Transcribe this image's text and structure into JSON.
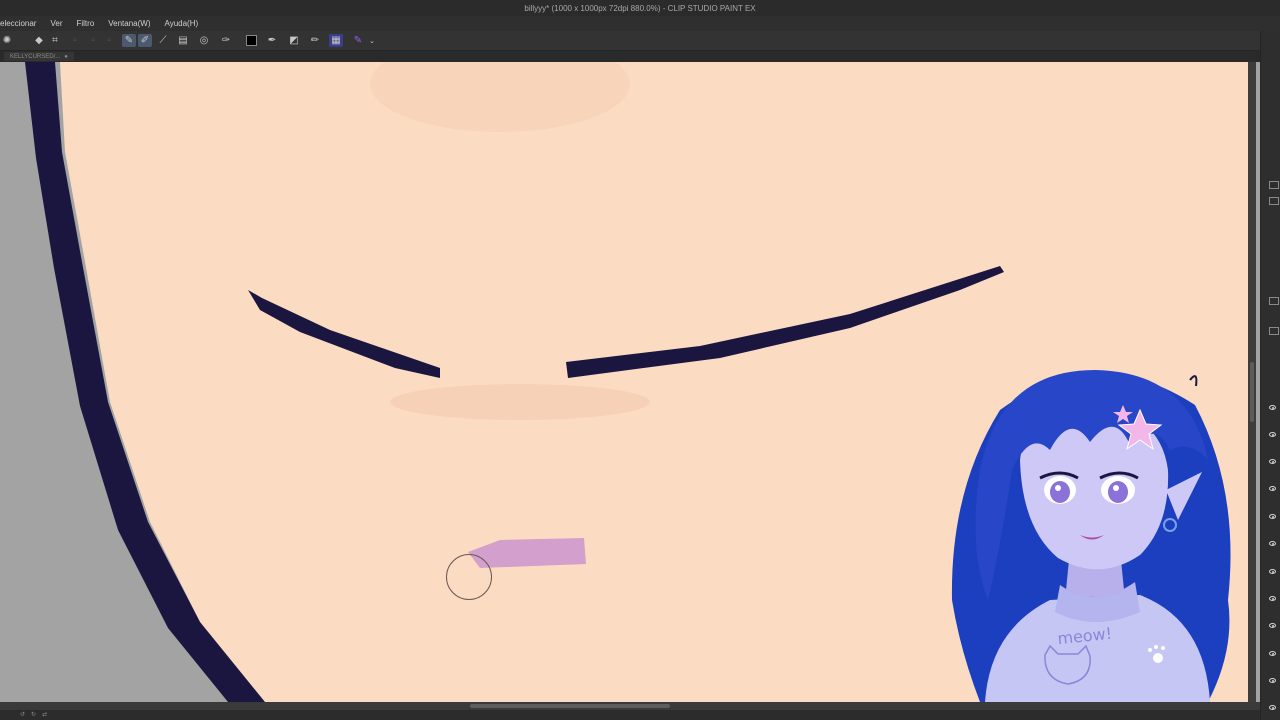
{
  "window": {
    "title": "billyyy* (1000 x 1000px 72dpi 880.0%)  - CLIP STUDIO PAINT EX"
  },
  "menu": {
    "items": [
      "eleccionar",
      "Ver",
      "Filtro",
      "Ventana(W)",
      "Ayuda(H)"
    ]
  },
  "command_bar": {
    "tools": [
      "loading-spinner-icon",
      "move-icon",
      "transform-icon",
      "blank-tool-icon",
      "blank-tool-icon",
      "blank-tool-icon",
      "pen-active-icon",
      "pen-edit-icon",
      "ruler-icon",
      "layer-property-icon",
      "lasso-icon",
      "pencil-icon",
      "color-square-icon",
      "eyedropper-icon",
      "selection-icon",
      "vector-pen-icon",
      "layer-color-icon",
      "purple-pen-icon"
    ],
    "colors": {
      "main_color": "#000000",
      "accent_purple": "#7a3fd6"
    }
  },
  "tab": {
    "label": "KELLYCURSED/..."
  },
  "canvas": {
    "background_skin": "#fbdcc2",
    "line_color": "#1b1640",
    "blush_color": "#f4c7b0",
    "stroke_color": "#d39fcc",
    "outside_gray": "#a3a3a3",
    "zoom": "880.0%"
  },
  "avatar": {
    "hair_color": "#1c3fbf",
    "sweater_color": "#c6c6f4",
    "sweater_text": "meow!"
  },
  "right_panel": {
    "eye_count": 12
  }
}
